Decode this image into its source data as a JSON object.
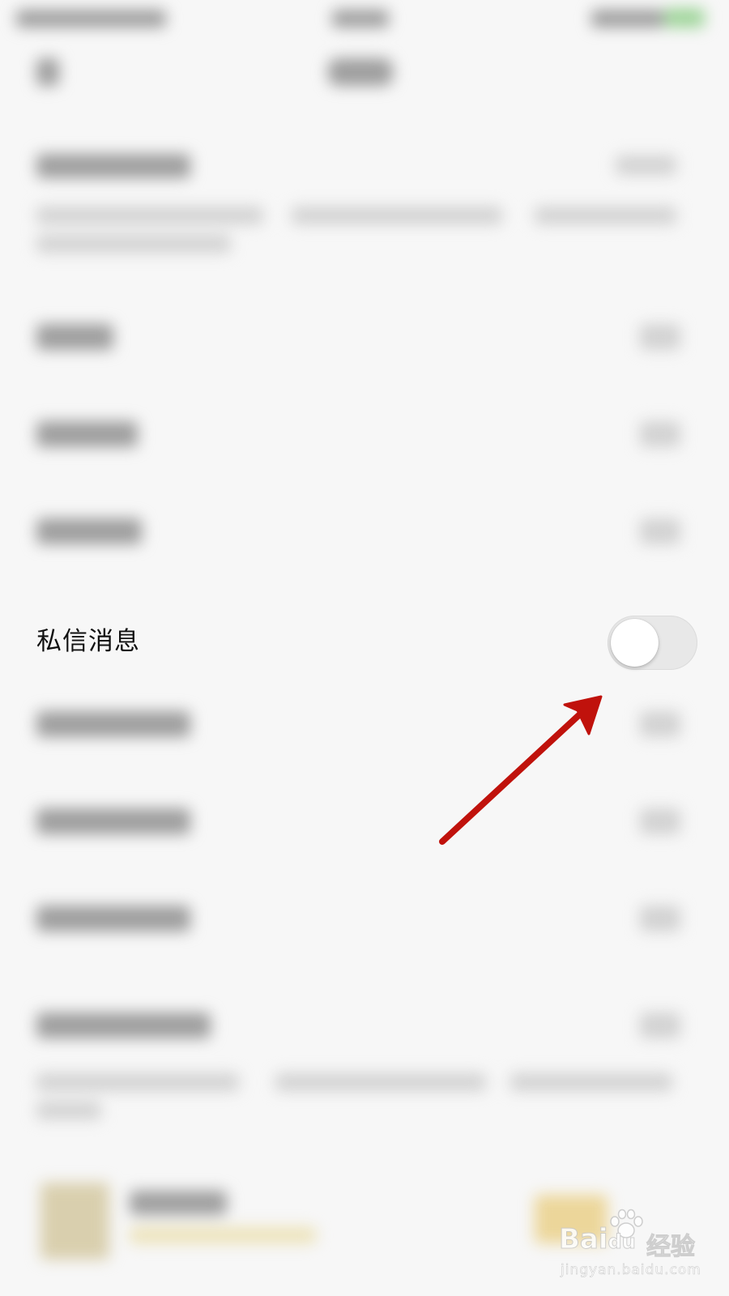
{
  "setting_row": {
    "label": "私信消息",
    "toggle_state": "off"
  },
  "annotation": {
    "arrow_color": "#c0120c"
  },
  "watermark": {
    "brand": "Bai",
    "brand_tail": "du",
    "chinese": "经验",
    "url": "jingyan.baidu.com"
  },
  "colors": {
    "background": "#f7f7f7",
    "toggle_track_off": "#e8e8e8",
    "toggle_knob": "#ffffff",
    "label_text": "#111111"
  }
}
